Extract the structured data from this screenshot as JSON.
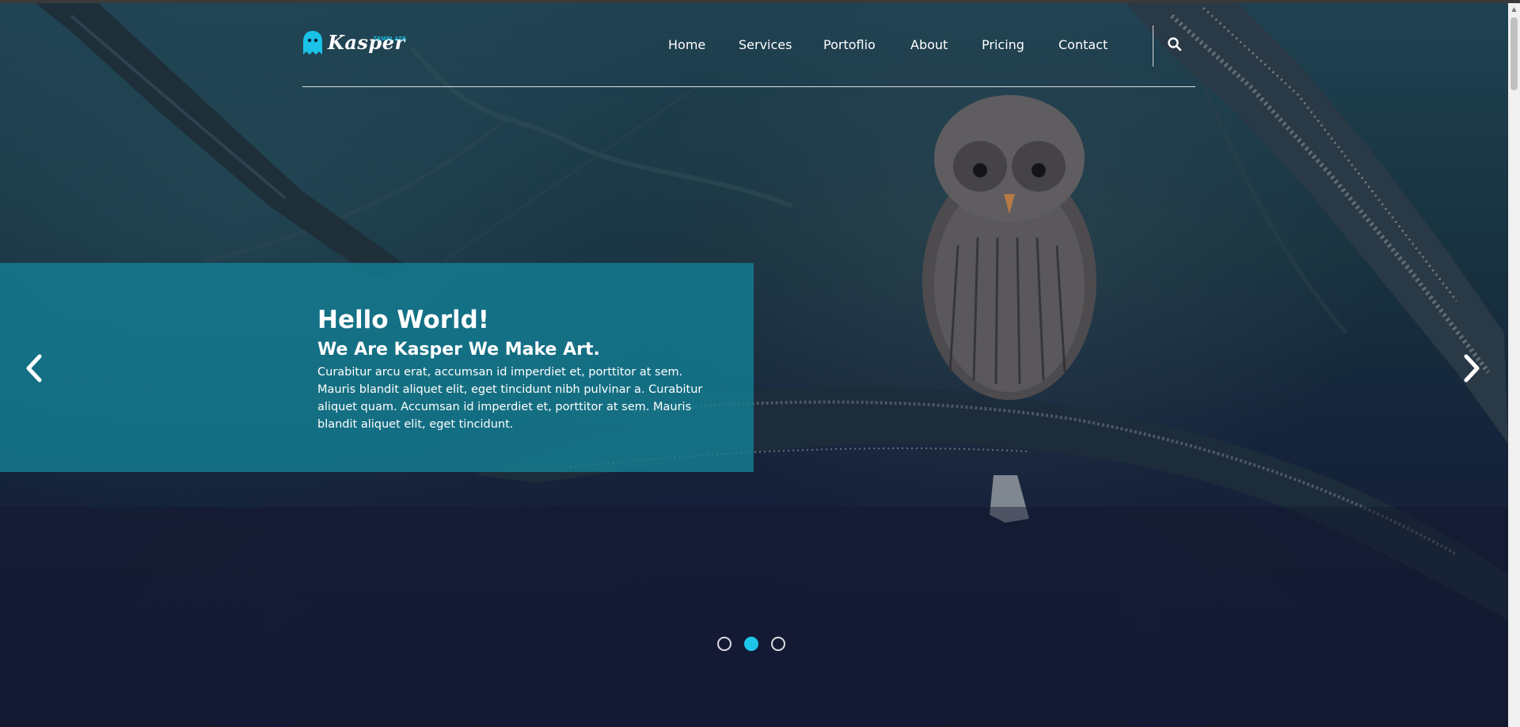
{
  "logo": {
    "brand": "Kasper",
    "tagline": "TEMPLATE",
    "accent_color": "#19c2e6",
    "icon": "ghost-icon"
  },
  "nav": {
    "items": [
      {
        "label": "Home"
      },
      {
        "label": "Services"
      },
      {
        "label": "Portoflio"
      },
      {
        "label": "About"
      },
      {
        "label": "Pricing"
      },
      {
        "label": "Contact"
      }
    ],
    "search_icon": "search-icon"
  },
  "slide": {
    "title": "Hello World!",
    "subtitle": "We Are Kasper We Make Art.",
    "body": "Curabitur arcu erat, accumsan id imperdiet et, porttitor at sem. Mauris blandit aliquet elit, eget tincidunt nibh pulvinar a. Curabitur aliquet quam. Accumsan id imperdiet et, porttitor at sem. Mauris blandit aliquet elit, eget tincidunt.",
    "caption_color": "#147e92"
  },
  "carousel": {
    "prev_icon": "chevron-left-icon",
    "next_icon": "chevron-right-icon",
    "slide_count": 3,
    "active_index": 1,
    "active_color": "#1ec5ea"
  }
}
